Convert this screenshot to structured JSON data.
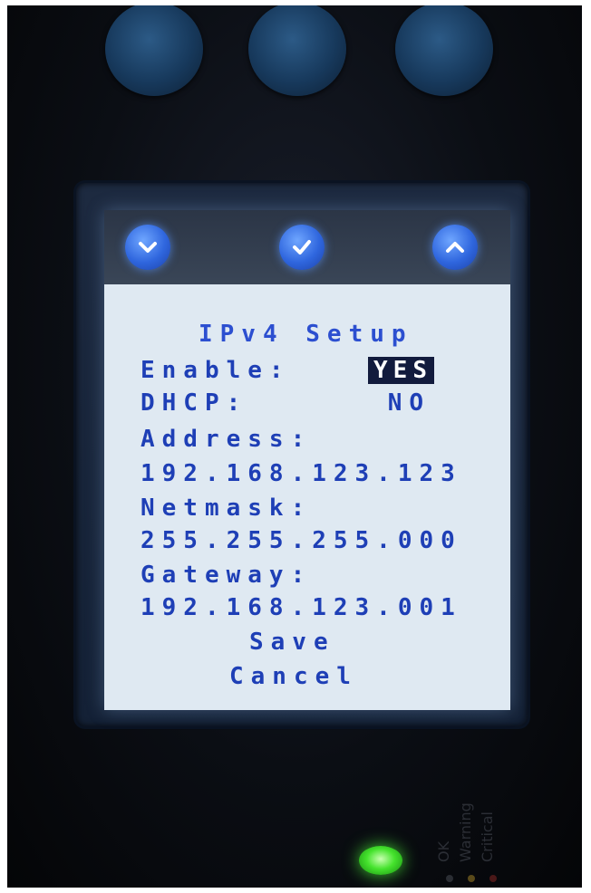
{
  "colors": {
    "screen_background": "#dfe9f2",
    "text": "#1e3fb6",
    "selection_background": "#121b3d",
    "selection_text": "#ffffff",
    "led_ok": "#45e32d"
  },
  "nav": [
    {
      "icon": "chevron-down-icon"
    },
    {
      "icon": "checkmark-icon"
    },
    {
      "icon": "chevron-up-icon"
    }
  ],
  "menu": {
    "title": "IPv4 Setup",
    "enable_label": "Enable:",
    "enable_value": "YES",
    "dhcp_label": "DHCP:",
    "dhcp_value": "NO",
    "address_label": "Address:",
    "address_value": "192.168.123.123",
    "netmask_label": "Netmask:",
    "netmask_value": "255.255.255.000",
    "gateway_label": "Gateway:",
    "gateway_value": "192.168.123.001",
    "save_label": "Save",
    "cancel_label": "Cancel"
  },
  "indicators": {
    "ok_label": "OK",
    "warning_label": "Warning",
    "critical_label": "Critical"
  }
}
